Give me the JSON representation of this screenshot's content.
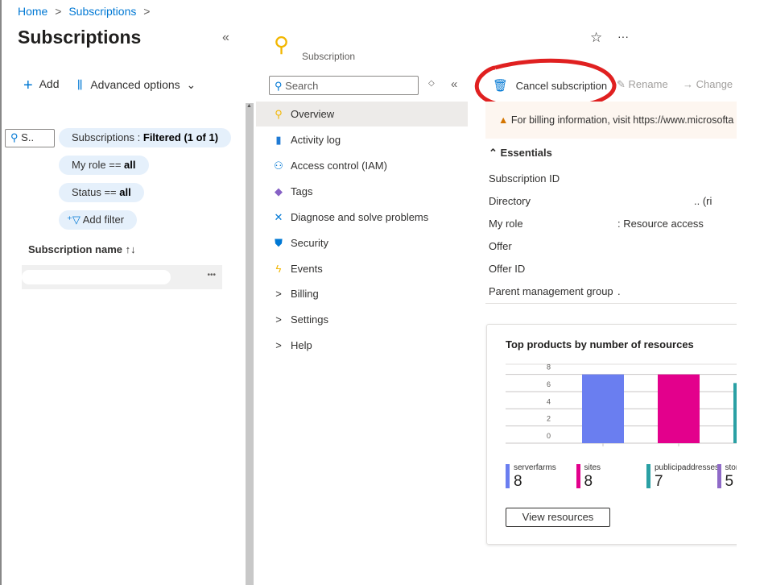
{
  "breadcrumb": {
    "home": "Home",
    "subscriptions": "Subscriptions",
    "sep": ">"
  },
  "left": {
    "title": "Subscriptions",
    "collapse": "«",
    "toolbar": {
      "add": "Add",
      "advanced": "Advanced options"
    },
    "search_placeholder": "S..",
    "filters": [
      {
        "label": "Subscriptions : ",
        "value": "Filtered (1 of 1)"
      },
      {
        "label": "My role == ",
        "value": "all"
      },
      {
        "label": "Status == ",
        "value": "all"
      }
    ],
    "add_filter": "Add filter",
    "column_header": "Subscription name",
    "sort_icon": "↑↓",
    "row_more": "•••"
  },
  "blade": {
    "subtitle": "Subscription",
    "search_placeholder": "Search",
    "nav": [
      {
        "label": "Overview",
        "icon": "key-icon",
        "selected": true
      },
      {
        "label": "Activity log",
        "icon": "activity-log-icon"
      },
      {
        "label": "Access control (IAM)",
        "icon": "people-icon"
      },
      {
        "label": "Tags",
        "icon": "tag-icon"
      },
      {
        "label": "Diagnose and solve problems",
        "icon": "wrench-icon"
      },
      {
        "label": "Security",
        "icon": "shield-icon"
      },
      {
        "label": "Events",
        "icon": "lightning-icon"
      },
      {
        "label": "Billing",
        "icon": "chevron-right-icon"
      },
      {
        "label": "Settings",
        "icon": "chevron-right-icon"
      },
      {
        "label": "Help",
        "icon": "chevron-right-icon"
      }
    ],
    "commands": {
      "cancel": "Cancel subscription",
      "rename": "Rename",
      "change": "Change"
    },
    "banner": "For billing information, visit https://www.microsofta",
    "essentials_title": "Essentials",
    "essentials": [
      {
        "label": "Subscription ID",
        "value": ""
      },
      {
        "label": "Directory",
        "value": ".. (ri"
      },
      {
        "label": "My role",
        "value": ":  Resource access"
      },
      {
        "label": "Offer",
        "value": ""
      },
      {
        "label": "Offer ID",
        "value": ""
      },
      {
        "label": "Parent management group",
        "value": "."
      }
    ],
    "view_resources": "View resources"
  },
  "chart_data": {
    "type": "bar",
    "title": "Top products by number of resources",
    "categories": [
      "serverfarms",
      "sites",
      "publicipaddresses",
      "stora"
    ],
    "values": [
      8,
      8,
      7,
      5
    ],
    "colors": [
      "#6a7ef0",
      "#e3008c",
      "#2aa0a4",
      "#8f6ac8"
    ],
    "yticks": [
      0,
      2,
      4,
      6,
      8
    ],
    "ylim": [
      0,
      9
    ],
    "grid": true
  },
  "colors": {
    "accent": "#0078d4",
    "annotation": "#e02020"
  }
}
